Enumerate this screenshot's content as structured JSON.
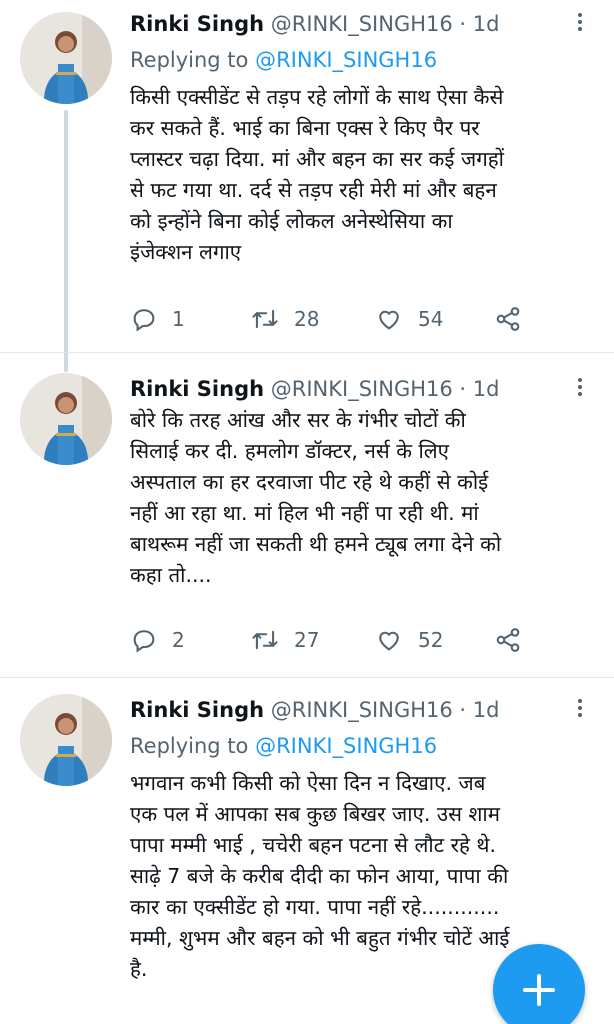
{
  "tweets": [
    {
      "name": "Rinki Singh",
      "handle": "@RINKI_SINGH16",
      "sep": "·",
      "time": "1d",
      "replying_prefix": "Replying to",
      "replying_to": "@RINKI_SINGH16",
      "lines": [
        "किसी एक्सीडेंट से तड़प रहे लोगों के साथ ऐसा कैसे",
        "कर सकते हैं. भाई का बिना एक्स रे किए पैर पर",
        "प्लास्टर चढ़ा दिया. मां और बहन का सर कई जगहों",
        "से फट गया था. दर्द से तड़प रही मेरी मां और बहन",
        "को इन्होंने बिना कोई लोकल अनेस्थेसिया का",
        "इंजेक्शन लगाए"
      ],
      "replies": "1",
      "retweets": "28",
      "likes": "54"
    },
    {
      "name": "Rinki Singh",
      "handle": "@RINKI_SINGH16",
      "sep": "·",
      "time": "1d",
      "lines": [
        "बोरे कि तरह आंख और सर के गंभीर चोटों की",
        "सिलाई कर दी. हमलोग डॉक्टर, नर्स के लिए",
        "अस्पताल का हर दरवाजा पीट रहे थे कहीं से कोई",
        "नहीं आ रहा था. मां हिल भी नहीं पा रही थी. मां",
        "बाथरूम नहीं जा सकती थी हमने ट्यूब लगा देने को",
        "कहा तो...."
      ],
      "replies": "2",
      "retweets": "27",
      "likes": "52"
    },
    {
      "name": "Rinki Singh",
      "handle": "@RINKI_SINGH16",
      "sep": "·",
      "time": "1d",
      "replying_prefix": "Replying to",
      "replying_to": "@RINKI_SINGH16",
      "lines": [
        "भगवान कभी किसी को ऐसा दिन न दिखाए. जब",
        "एक पल में आपका सब कुछ बिखर जाए. उस शाम",
        "पापा मम्मी भाई , चचेरी बहन पटना से लौट रहे थे.",
        "साढ़े 7 बजे के करीब दीदी का फोन आया, पापा की",
        "कार का एक्सीडेंट हो गया. पापा नहीं रहे............",
        "मम्मी, शुभम और बहन को भी बहुत गंभीर चोटें आई",
        "है."
      ]
    }
  ],
  "icons": {
    "reply": "reply-icon",
    "retweet": "retweet-icon",
    "like": "heart-icon",
    "share": "share-icon",
    "more": "more-icon",
    "compose": "plus-icon"
  },
  "colors": {
    "accent": "#1d9bf0",
    "secondary_text": "#536471",
    "divider": "#e1e8ed"
  }
}
